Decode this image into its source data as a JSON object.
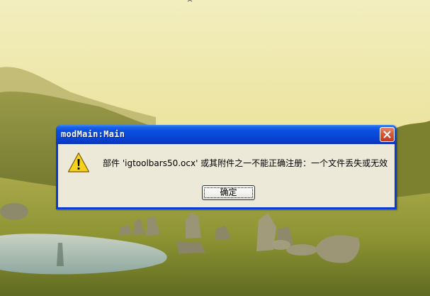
{
  "dialog": {
    "title": "modMain:Main",
    "message": "部件 'igtoolbars50.ocx' 或其附件之一不能正确注册：一个文件丢失或无效",
    "ok_label": "确定",
    "icon": "warning-icon"
  },
  "colors": {
    "titlebar": "#0847d6",
    "dialog_bg": "#ece9d8",
    "close_button": "#d8573a"
  }
}
